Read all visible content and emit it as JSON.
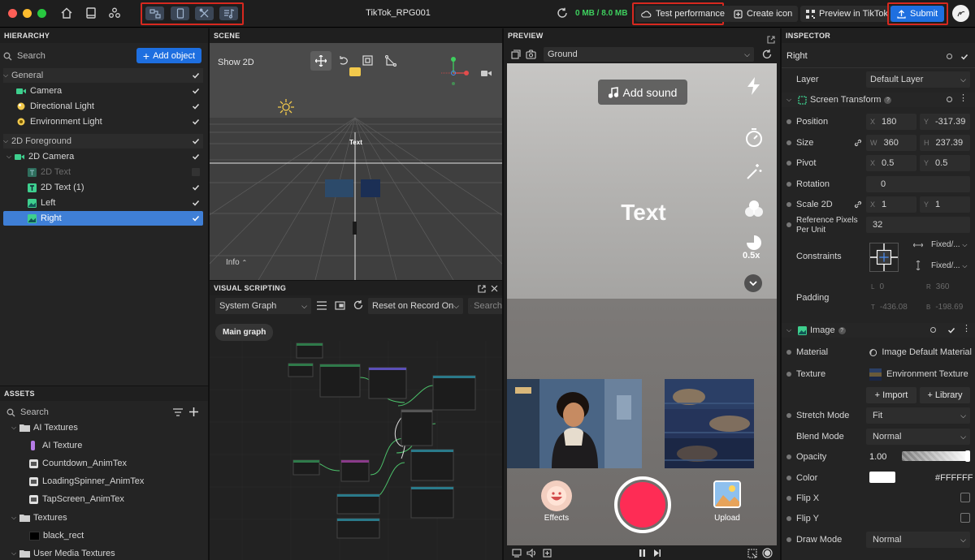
{
  "toolbar": {
    "title": "TikTok_RPG001",
    "memory": "0 MB / 8.0 MB",
    "test_performance": "Test performance",
    "create_icon": "Create icon",
    "preview_tiktok": "Preview in TikTok",
    "submit": "Submit"
  },
  "hierarchy": {
    "title": "HIERARCHY",
    "search_placeholder": "Search",
    "add_object": "Add object",
    "items": [
      {
        "label": "General"
      },
      {
        "label": "Camera"
      },
      {
        "label": "Directional Light"
      },
      {
        "label": "Environment Light"
      },
      {
        "label": "2D Foreground"
      },
      {
        "label": "2D Camera"
      },
      {
        "label": "2D Text"
      },
      {
        "label": "2D Text (1)"
      },
      {
        "label": "Left"
      },
      {
        "label": "Right"
      }
    ]
  },
  "assets": {
    "title": "ASSETS",
    "search_placeholder": "Search",
    "items": [
      {
        "label": "AI Textures"
      },
      {
        "label": "AI Texture"
      },
      {
        "label": "Countdown_AnimTex"
      },
      {
        "label": "LoadingSpinner_AnimTex"
      },
      {
        "label": "TapScreen_AnimTex"
      },
      {
        "label": "Textures"
      },
      {
        "label": "black_rect"
      },
      {
        "label": "User Media Textures"
      }
    ]
  },
  "scene": {
    "title": "SCENE",
    "show2d": "Show 2D",
    "text_label": "Text",
    "info": "Info"
  },
  "scripting": {
    "title": "VISUAL SCRIPTING",
    "graph_select": "System Graph",
    "reset_select": "Reset on Record On",
    "search_placeholder": "Search",
    "main_graph": "Main graph"
  },
  "preview": {
    "title": "PREVIEW",
    "ground_select": "Ground",
    "add_sound": "Add sound",
    "center_text": "Text",
    "speed": "0.5x",
    "effects": "Effects",
    "upload": "Upload"
  },
  "inspector": {
    "title": "INSPECTOR",
    "object_name": "Right",
    "layer_label": "Layer",
    "layer_value": "Default Layer",
    "screen_transform": "Screen Transform",
    "position": {
      "label": "Position",
      "x": "180",
      "y": "-317.39"
    },
    "size": {
      "label": "Size",
      "w": "360",
      "h": "237.39"
    },
    "pivot": {
      "label": "Pivot",
      "x": "0.5",
      "y": "0.5"
    },
    "rotation": {
      "label": "Rotation",
      "value": "0"
    },
    "scale2d": {
      "label": "Scale 2D",
      "x": "1",
      "y": "1"
    },
    "ref_pixels": {
      "label": "Reference Pixels Per Unit",
      "value": "32"
    },
    "constraints": {
      "label": "Constraints",
      "h": "Fixed/...",
      "v": "Fixed/..."
    },
    "padding": {
      "label": "Padding",
      "l": "0",
      "r": "360",
      "t": "-436.08",
      "b": "-198.69"
    },
    "image": "Image",
    "material": {
      "label": "Material",
      "value": "Image Default Material"
    },
    "texture": {
      "label": "Texture",
      "value": "Environment Texture"
    },
    "import": "+ Import",
    "library": "+ Library",
    "stretch": {
      "label": "Stretch Mode",
      "value": "Fit"
    },
    "blend": {
      "label": "Blend Mode",
      "value": "Normal"
    },
    "opacity": {
      "label": "Opacity",
      "value": "1.00"
    },
    "color": {
      "label": "Color",
      "value": "#FFFFFF"
    },
    "flipx": "Flip X",
    "flipy": "Flip Y",
    "draw": {
      "label": "Draw Mode",
      "value": "Normal"
    }
  },
  "colors": {
    "accent": "#1e6fe0",
    "highlight": "#d7281f",
    "record": "#fe2c55",
    "gizmo_green": "#3ecf5e"
  }
}
